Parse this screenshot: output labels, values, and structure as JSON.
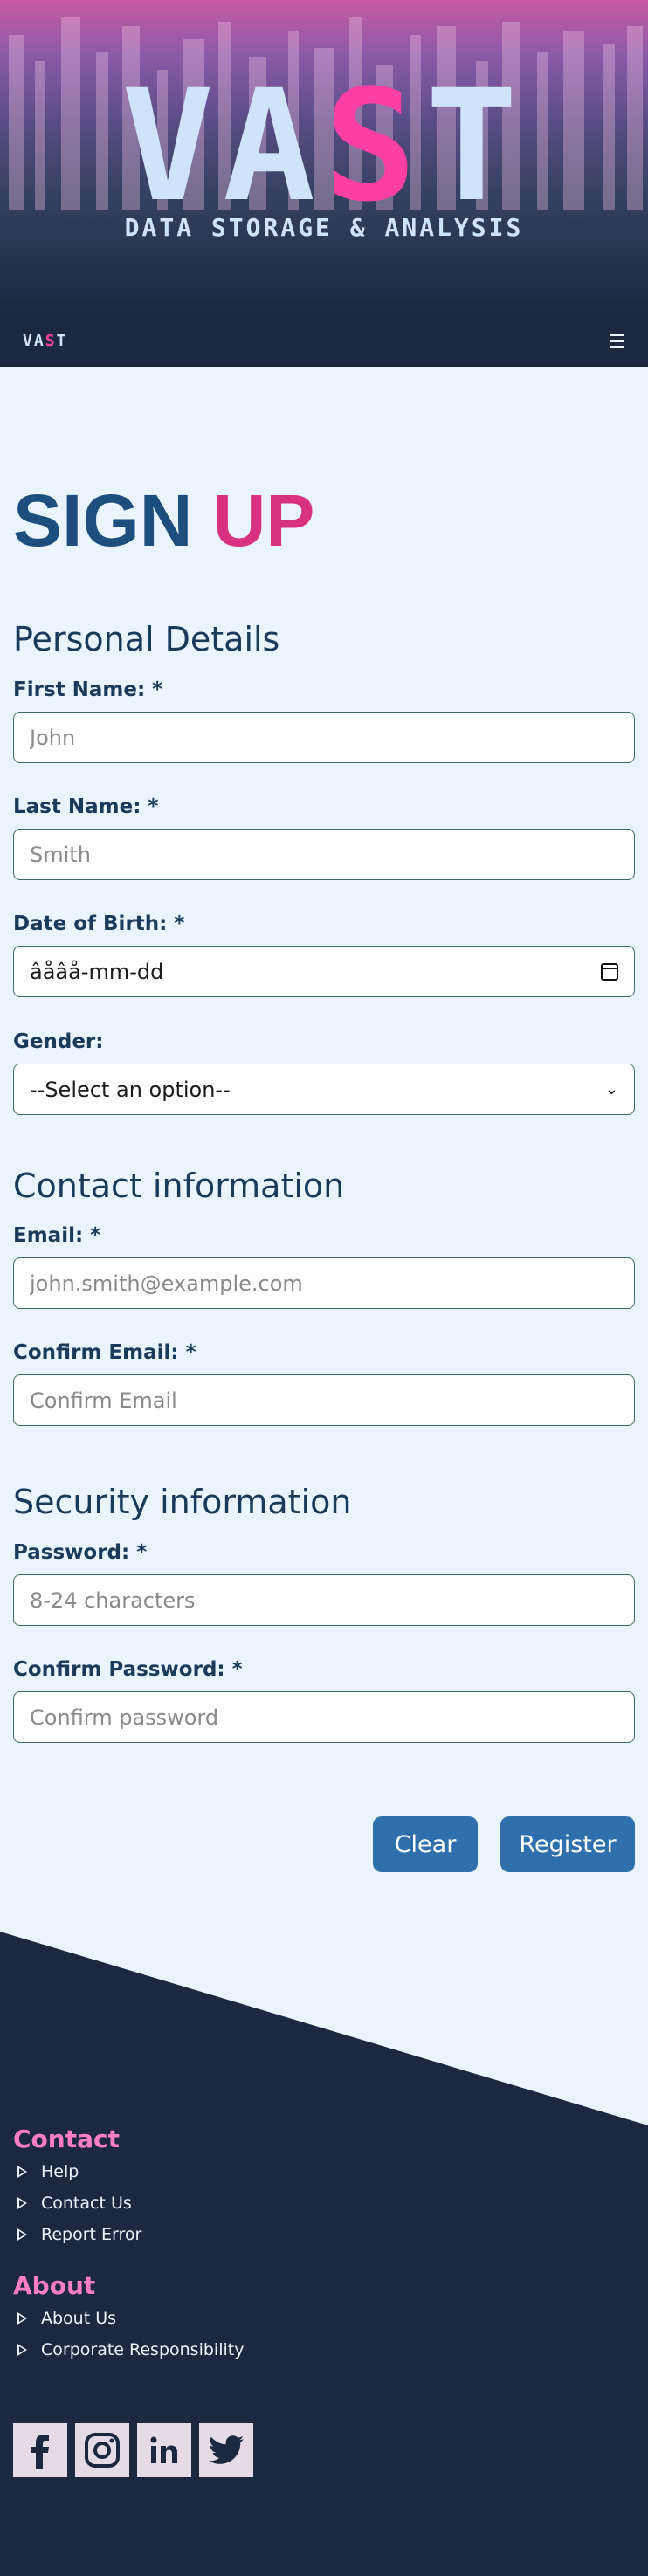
{
  "hero": {
    "title_part1": "VA",
    "title_highlight": "S",
    "title_part2": "T",
    "subtitle": "DATA STORAGE & ANALYSIS"
  },
  "nav": {
    "logo_part1": "VA",
    "logo_highlight": "S",
    "logo_part2": "T",
    "menu_icon": "hamburger-icon"
  },
  "form": {
    "title_word1": "SIGN",
    "title_word2": "UP",
    "personal": {
      "heading": "Personal Details",
      "first_name_label": "First Name: *",
      "first_name_placeholder": "John",
      "last_name_label": "Last Name: *",
      "last_name_placeholder": "Smith",
      "dob_label": "Date of Birth: *",
      "dob_value": "âåâå-mm-dd",
      "gender_label": "Gender:",
      "gender_value": "--Select an option--"
    },
    "contact": {
      "heading": "Contact information",
      "email_label": "Email: *",
      "email_placeholder": "john.smith@example.com",
      "confirm_email_label": "Confirm Email: *",
      "confirm_email_placeholder": "Confirm Email"
    },
    "security": {
      "heading": "Security information",
      "password_label": "Password: *",
      "password_placeholder": "8-24 characters",
      "confirm_password_label": "Confirm Password: *",
      "confirm_password_placeholder": "Confirm password"
    },
    "buttons": {
      "clear": "Clear",
      "register": "Register"
    }
  },
  "footer": {
    "contact_heading": "Contact",
    "contact_links": [
      "Help",
      "Contact Us",
      "Report Error"
    ],
    "about_heading": "About",
    "about_links": [
      "About Us",
      "Corporate Responsibility"
    ],
    "social_icons": [
      "facebook-icon",
      "instagram-icon",
      "linkedin-icon",
      "twitter-icon"
    ]
  },
  "colors": {
    "accent_pink": "#ff3fa3",
    "heading_blue": "#1d4e7e",
    "button_blue": "#2f6fac",
    "footer_bg": "#1b2840",
    "page_bg": "#e9f4fe"
  }
}
